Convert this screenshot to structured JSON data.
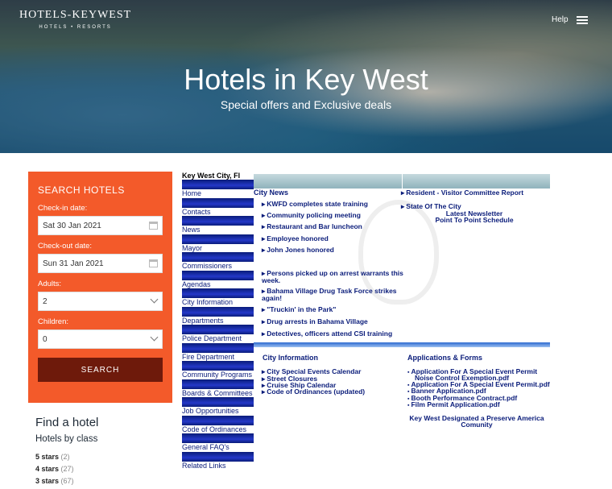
{
  "header": {
    "logo_main": "HOTELS-KEYWEST",
    "logo_sub": "HOTELS • RESORTS",
    "help_label": "Help",
    "hero_title": "Hotels in Key West",
    "hero_subtitle": "Special offers and Exclusive deals"
  },
  "search": {
    "title": "SEARCH HOTELS",
    "checkin_label": "Check-in date:",
    "checkin_value": "Sat 30 Jan 2021",
    "checkout_label": "Check-out date:",
    "checkout_value": "Sun 31 Jan 2021",
    "adults_label": "Adults:",
    "adults_value": "2",
    "children_label": "Children:",
    "children_value": "0",
    "button_label": "SEARCH"
  },
  "find": {
    "title": "Find a hotel",
    "subtitle": "Hotels by class",
    "classes": [
      {
        "label": "5 stars",
        "count": "(2)"
      },
      {
        "label": "4 stars",
        "count": "(27)"
      },
      {
        "label": "3 stars",
        "count": "(67)"
      }
    ]
  },
  "city_nav": {
    "title": "Key West City, Fl",
    "items": [
      "Home",
      "Contacts",
      "News",
      "Mayor",
      "Commissioners",
      "Agendas",
      "City Information",
      "Departments",
      "Police Department",
      "Fire Department",
      "Community Programs",
      "Boards & Committees",
      "Job Opportunities",
      "Code of Ordinances",
      "General FAQ's",
      "Related Links"
    ]
  },
  "city_content": {
    "news_heading": "City News",
    "news": [
      "KWFD completes state training",
      "Community policing meeting",
      "Restaurant and Bar luncheon",
      "Employee honored",
      "John Jones honored"
    ],
    "news2": [
      "Persons picked up on arrest warrants this",
      "week.",
      "Bahama Village Drug Task Force strikes",
      "again!",
      "\"Truckin' in the Park\"",
      "Drug arrests in Bahama Village",
      "Detectives, officers attend CSI training"
    ],
    "right_links": [
      "Resident - Visitor Committee Report",
      "State Of The City"
    ],
    "newsletter": "Latest Newsletter",
    "schedule": "Point To Point Schedule",
    "info_heading": "City Information",
    "info": [
      "City Special Events Calendar",
      "Street Closures",
      "Cruise Ship Calendar",
      "Code of Ordinances (updated)"
    ],
    "apps_heading": "Applications & Forms",
    "apps": [
      "Application For A Special Event Permit",
      "Noise Control Exemption.pdf",
      "Application For A Special Event Permit.pdf",
      "Banner Application.pdf",
      "Booth Performance Contract.pdf",
      "Film Permit Application.pdf"
    ],
    "designation_1": "Key West Designated a Preserve America",
    "designation_2": "Comunity"
  },
  "colors": {
    "search_bg": "#f35a2a",
    "search_button": "#6e1a0b",
    "nav_blue": "#0a1c7a"
  }
}
